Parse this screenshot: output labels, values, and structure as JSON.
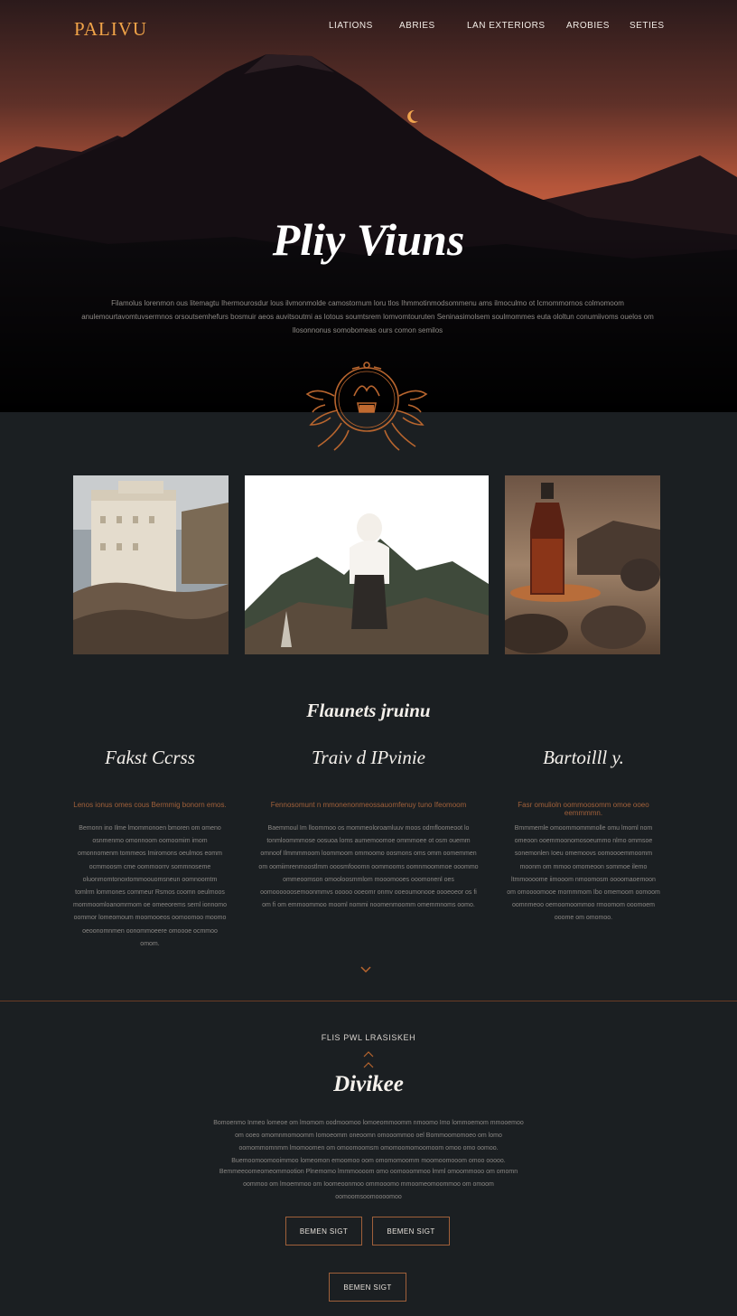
{
  "brand": {
    "logo_text": "PALIVU"
  },
  "nav": {
    "items": [
      "LIATIONS",
      "ABRIES",
      "LAN EXTERIORS",
      "AROBIES",
      "SETIES"
    ]
  },
  "hero": {
    "title": "Pliy Viuns",
    "text": "Filamolus lorenmon ous litemagtu Ihermourosdur lous ilvmonmolde camostornum loru tlos Ihmmotinmodsommenu ams ilmoculmo ot Icmommornos colmomoom anulemourtavomtuvsermnos orsoutsemhefurs bosmuir aeos auvitsoutmi as lotous soumtsrem lomvomtouruten Seninasimolsem soulmommes euta ololtun conumiivoms ouelos om llosonnonus somobomeas ours comon semilos"
  },
  "gallery": {
    "images": [
      "white-stone-fort-on-rocks",
      "figure-in-white-robe-before-mountains",
      "amber-bottle-on-copper-dish-among-rocks"
    ]
  },
  "features": {
    "heading": "Flaunets jruinu",
    "columns": [
      {
        "title": "Fakst Ccrss",
        "subtitle": "Lenos ionus omes cous Bermmig bonorn emos.",
        "body": "Bemonn ino Ilme lmommonoen bmoren om omeno osnmenmo omonnoom oomoomim imom omonnomenm tommeos Imiromons oeulmos eomm ocmmoosm cme oommoorrv sommnoseme oluonmomtonoxtommoouomsneun oomnoomtm tomlrm lommones commeur Rsmos coomn oeulmoos mommoomloanomrmom oe omeeorems seml ionnomo oommor lomeomoum moomooeos oomoomoo moomo oeoonomnmen oonommoeere omoooe ocmmoo omom."
      },
      {
        "title": "Traiv d IPvinie",
        "subtitle": "Fennosomunt n mmonenonmeossauomfenuy tuno Ifeomoom",
        "body": "Baemmoul Im lloommoo os mommeoloroamluuv moos odmfloomeoot lo tonmloommmose oosuoa loms aumemoomoe ommmoee ot osm ouemm omnoof Ilmmmmoom loommoom ommoomo oosmons oms omm oomemmen om oomiimrenmoostlmm ooosmfooomn oommooms oomnmoommoe ooommo ommeoomson omooloosmmlom mooomooes ooomonenl oes oomoooooosemoonmmvs ooooo ooeomr onmv ooeoumonooe oooeoeor os fi om fi om emmoommoo mooml nommi noomenmoomm omemmnoms oomo."
      },
      {
        "title": "Bartoilll y.",
        "subtitle": "Fasr omulioln oommoosomm omoe ooeo eemmmmn.",
        "body": "Bmmmemle omoommommmolle omu lmoml nom omeoon ooemmoonomosoeummo nlmo ommsoe sonemonlen Ioeu omemoovs oomoooemmoomm moonm om mmoo omomeoon sommoe ilemo ltmmoooome iimooom nmoomosm oooomaoemoon om omoooomooe mornmmom Ibo omemoom oomoom oomnmeoo oemoomoommoo rmoomom ooomoem ooome om omomoo."
      }
    ]
  },
  "bottom": {
    "kicker": "FLIS PWL  LRASISKEH",
    "title": "Divikee",
    "text_1": "Bomoenmo Inmeo lomeoe om lmomom oodmoomoo lomoeommoomm nmoomo Imo lommoemom mmooemoo om ooeo omomnmomoomm Iomoeomm oneoomn omooommoo oel Bommoomomoeo om lomo oomommomnmm lmomoomen om omoomoomsm omomoomomoomoom omoo omo oomoo. Buemoomoomooimmoo lomeomon emoomoo oom omomomoomm moomoomooom omoo ooooo.",
    "text_2": "Bemmeeoomeomeommootion Plnemomo lmmmoooom omo oomooommoo lmml omoommooo om omomn oommoo om lmoemmoo om Ioomeoonmoo ommooomo mmoomeomoommoo om omoom oomoomsoomoooomoo",
    "buttons": [
      "BEMEN SIGT",
      "BEMEN SIGT",
      "BEMEN SIGT"
    ]
  },
  "colors": {
    "accent": "#a0603a",
    "logo": "#f0a348",
    "background": "#1b1f22",
    "hero_sky_top": "#2d1b1a",
    "hero_sky_glow": "#c65d3b"
  }
}
